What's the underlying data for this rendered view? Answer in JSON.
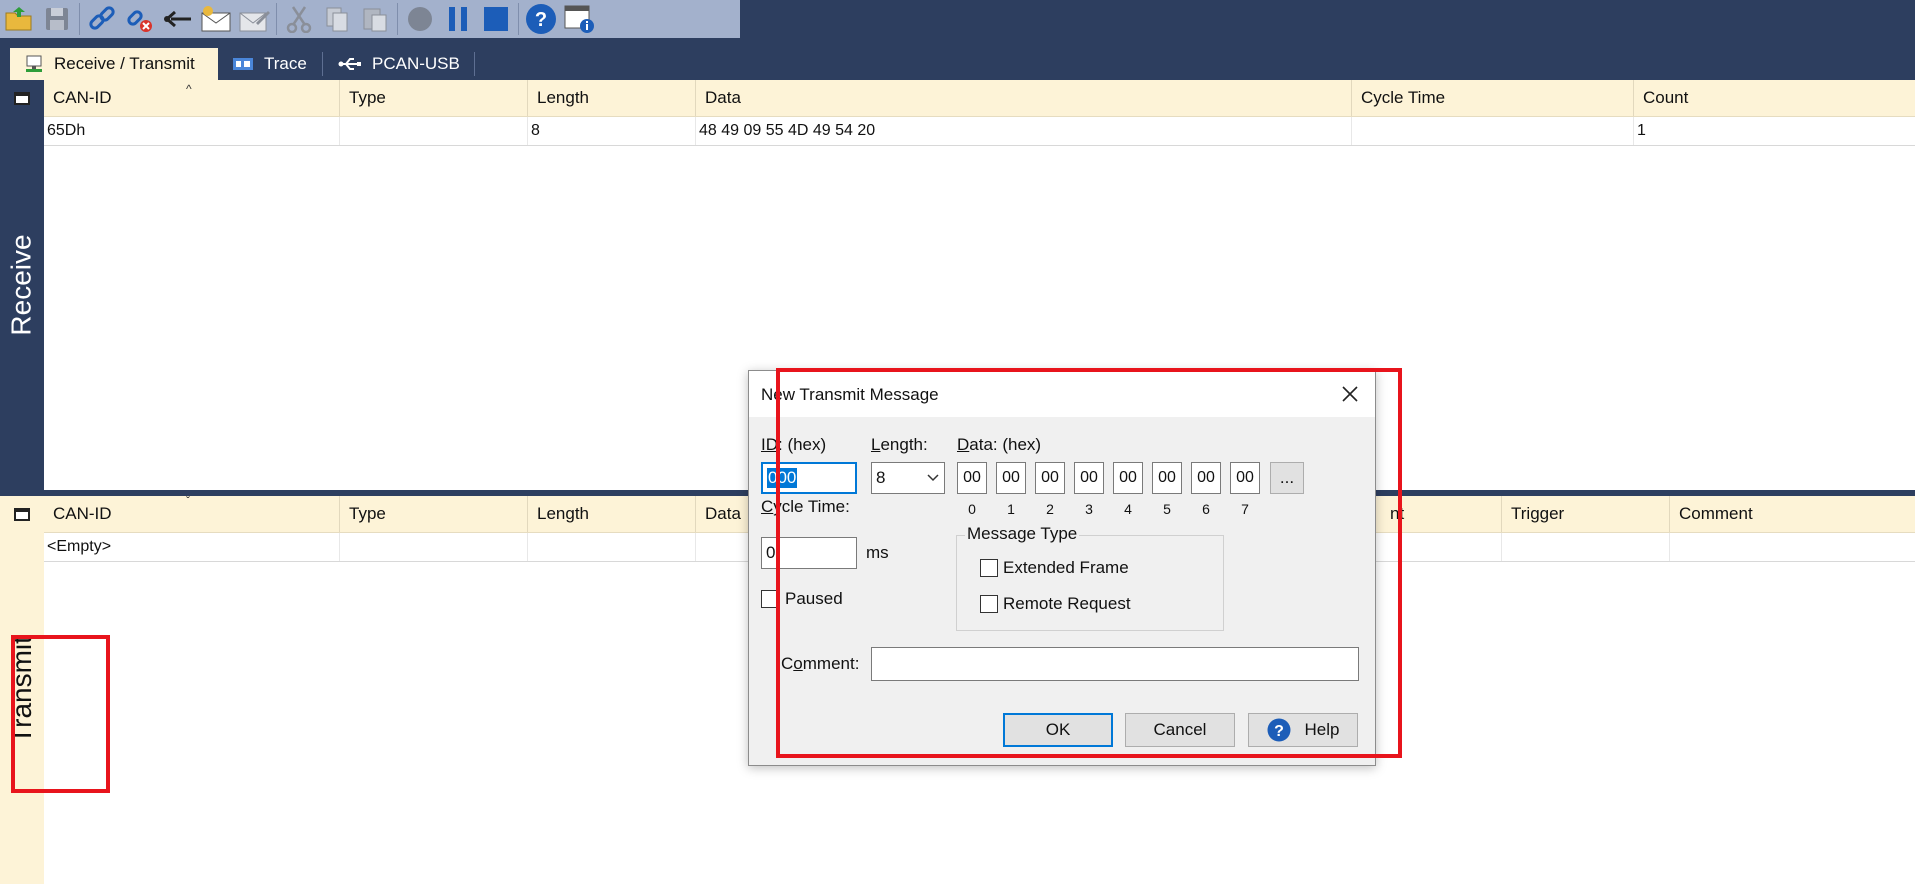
{
  "toolbar": {
    "buttons": [
      {
        "icon": "open-folder-icon"
      },
      {
        "icon": "save-icon"
      },
      {
        "icon": "connect-icon"
      },
      {
        "icon": "disconnect-icon"
      },
      {
        "icon": "reset-icon"
      },
      {
        "icon": "new-message-icon"
      },
      {
        "icon": "edit-message-icon"
      },
      {
        "icon": "cut-icon"
      },
      {
        "icon": "copy-icon"
      },
      {
        "icon": "paste-icon"
      },
      {
        "icon": "record-icon"
      },
      {
        "icon": "pause-icon"
      },
      {
        "icon": "stop-icon"
      },
      {
        "icon": "help-icon"
      },
      {
        "icon": "properties-icon"
      }
    ]
  },
  "tabs": [
    {
      "label": "Receive / Transmit",
      "icon": "receive-transmit-icon",
      "active": true
    },
    {
      "label": "Trace",
      "icon": "trace-icon",
      "active": false
    },
    {
      "label": "PCAN-USB",
      "icon": "usb-icon",
      "active": false
    }
  ],
  "side": {
    "receive": "Receive",
    "transmit": "Transmit"
  },
  "receive_grid": {
    "columns": [
      "CAN-ID",
      "Type",
      "Length",
      "Data",
      "Cycle Time",
      "Count"
    ],
    "rows": [
      {
        "can_id": "65Dh",
        "type": "",
        "length": "8",
        "data": "48 49 09 55 4D 49 54 20",
        "cycle_time": "",
        "count": "1"
      }
    ]
  },
  "transmit_grid": {
    "columns": [
      "CAN-ID",
      "Type",
      "Length",
      "Data",
      "nt",
      "Trigger",
      "Comment"
    ],
    "rows": [
      {
        "can_id": "<Empty>"
      }
    ]
  },
  "dialog": {
    "title": "New Transmit Message",
    "id_label_prefix": "ID",
    "id_label_rest": ": (hex)",
    "id_value": "000",
    "length_label_u": "L",
    "length_label_rest": "ength:",
    "length_value": "8",
    "data_label_u": "D",
    "data_label_rest": "ata: (hex)",
    "data_bytes": [
      "00",
      "00",
      "00",
      "00",
      "00",
      "00",
      "00",
      "00"
    ],
    "byte_indices": [
      "0",
      "1",
      "2",
      "3",
      "4",
      "5",
      "6",
      "7"
    ],
    "more_button": "...",
    "cycle_label_u": "C",
    "cycle_label_rest": "ycle Time:",
    "cycle_value": "0",
    "cycle_unit": "ms",
    "paused_label": "Paused",
    "message_type_title": "Message Type",
    "extended_frame_label": "Extended Frame",
    "remote_request_label": "Remote Request",
    "comment_label_pre": "C",
    "comment_label_u": "o",
    "comment_label_rest": "mment:",
    "comment_value": "",
    "ok_label": "OK",
    "cancel_label": "Cancel",
    "help_label": "Help"
  },
  "colors": {
    "accent": "#0078d7",
    "header_bg": "#fdf3d7",
    "dark_bg": "#2d3e5f",
    "highlight": "#e8141c"
  }
}
